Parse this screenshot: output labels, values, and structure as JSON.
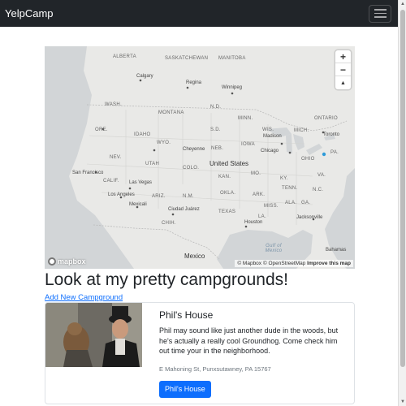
{
  "navbar": {
    "brand": "YelpCamp",
    "toggler_icon": "hamburger-menu-icon"
  },
  "map": {
    "zoom_in": "+",
    "zoom_out": "−",
    "compass": "▲",
    "logo_text": "mapbox",
    "attribution": {
      "mapbox": "© Mapbox",
      "osm": "© OpenStreetMap",
      "improve": "Improve this map"
    },
    "labels": {
      "alberta": "ALBERTA",
      "saskatchewan": "SASKATCHEWAN",
      "manitoba": "MANITOBA",
      "calgary": "Calgary",
      "regina": "Regina",
      "winnipeg": "Winnipeg",
      "wash": "WASH.",
      "montana": "MONTANA",
      "ndak": "N.D.",
      "ore": "ORE.",
      "idaho": "IDAHO",
      "sdak": "S.D.",
      "minn": "MINN.",
      "wis": "WIS.",
      "mich": "MICH.",
      "ontario": "ONTARIO",
      "toronto": "Toronto",
      "madison": "Madison",
      "chicago": "Chicago",
      "wyo": "WYO.",
      "neb": "NEB.",
      "iowa": "IOWA",
      "cheyenne": "Cheyenne",
      "ohio": "OHIO",
      "pa": "PA.",
      "nev": "NEV.",
      "utah": "UTAH",
      "united_states": "United States",
      "san_francisco": "San Francisco",
      "calif": "CALIF.",
      "colo": "COLO.",
      "kan": "KAN.",
      "mo": "MO.",
      "ky": "KY.",
      "va": "VA.",
      "las_vegas": "Las Vegas",
      "okla": "OKLA.",
      "tenn": "TENN.",
      "nc": "N.C.",
      "los_angeles": "Los Angeles",
      "ariz": "ARIZ.",
      "nm": "N.M.",
      "ark": "ARK.",
      "ala": "ALA.",
      "mexicali": "Mexicali",
      "miss": "MISS.",
      "ga": "GA.",
      "ciudad_juarez": "Ciudad Juárez",
      "texas": "TEXAS",
      "la": "LA.",
      "jacksonville": "Jacksonville",
      "houston": "Houston",
      "chih": "CHIH.",
      "gulf_of_mexico": "Gulf of Mexico",
      "bahamas": "Bahamas",
      "mexico": "Mexico"
    }
  },
  "page": {
    "title": "Look at my pretty campgrounds!",
    "add_link": "Add New Campground"
  },
  "campgrounds": [
    {
      "title": "Phil's House",
      "description": "Phil may sound like just another dude in the woods, but he's actually a really cool Groundhog. Come check him out time your in the neighborhood.",
      "location": "E Mahoning St, Punxsutawney, PA 15767",
      "button": "Phil's House"
    }
  ]
}
